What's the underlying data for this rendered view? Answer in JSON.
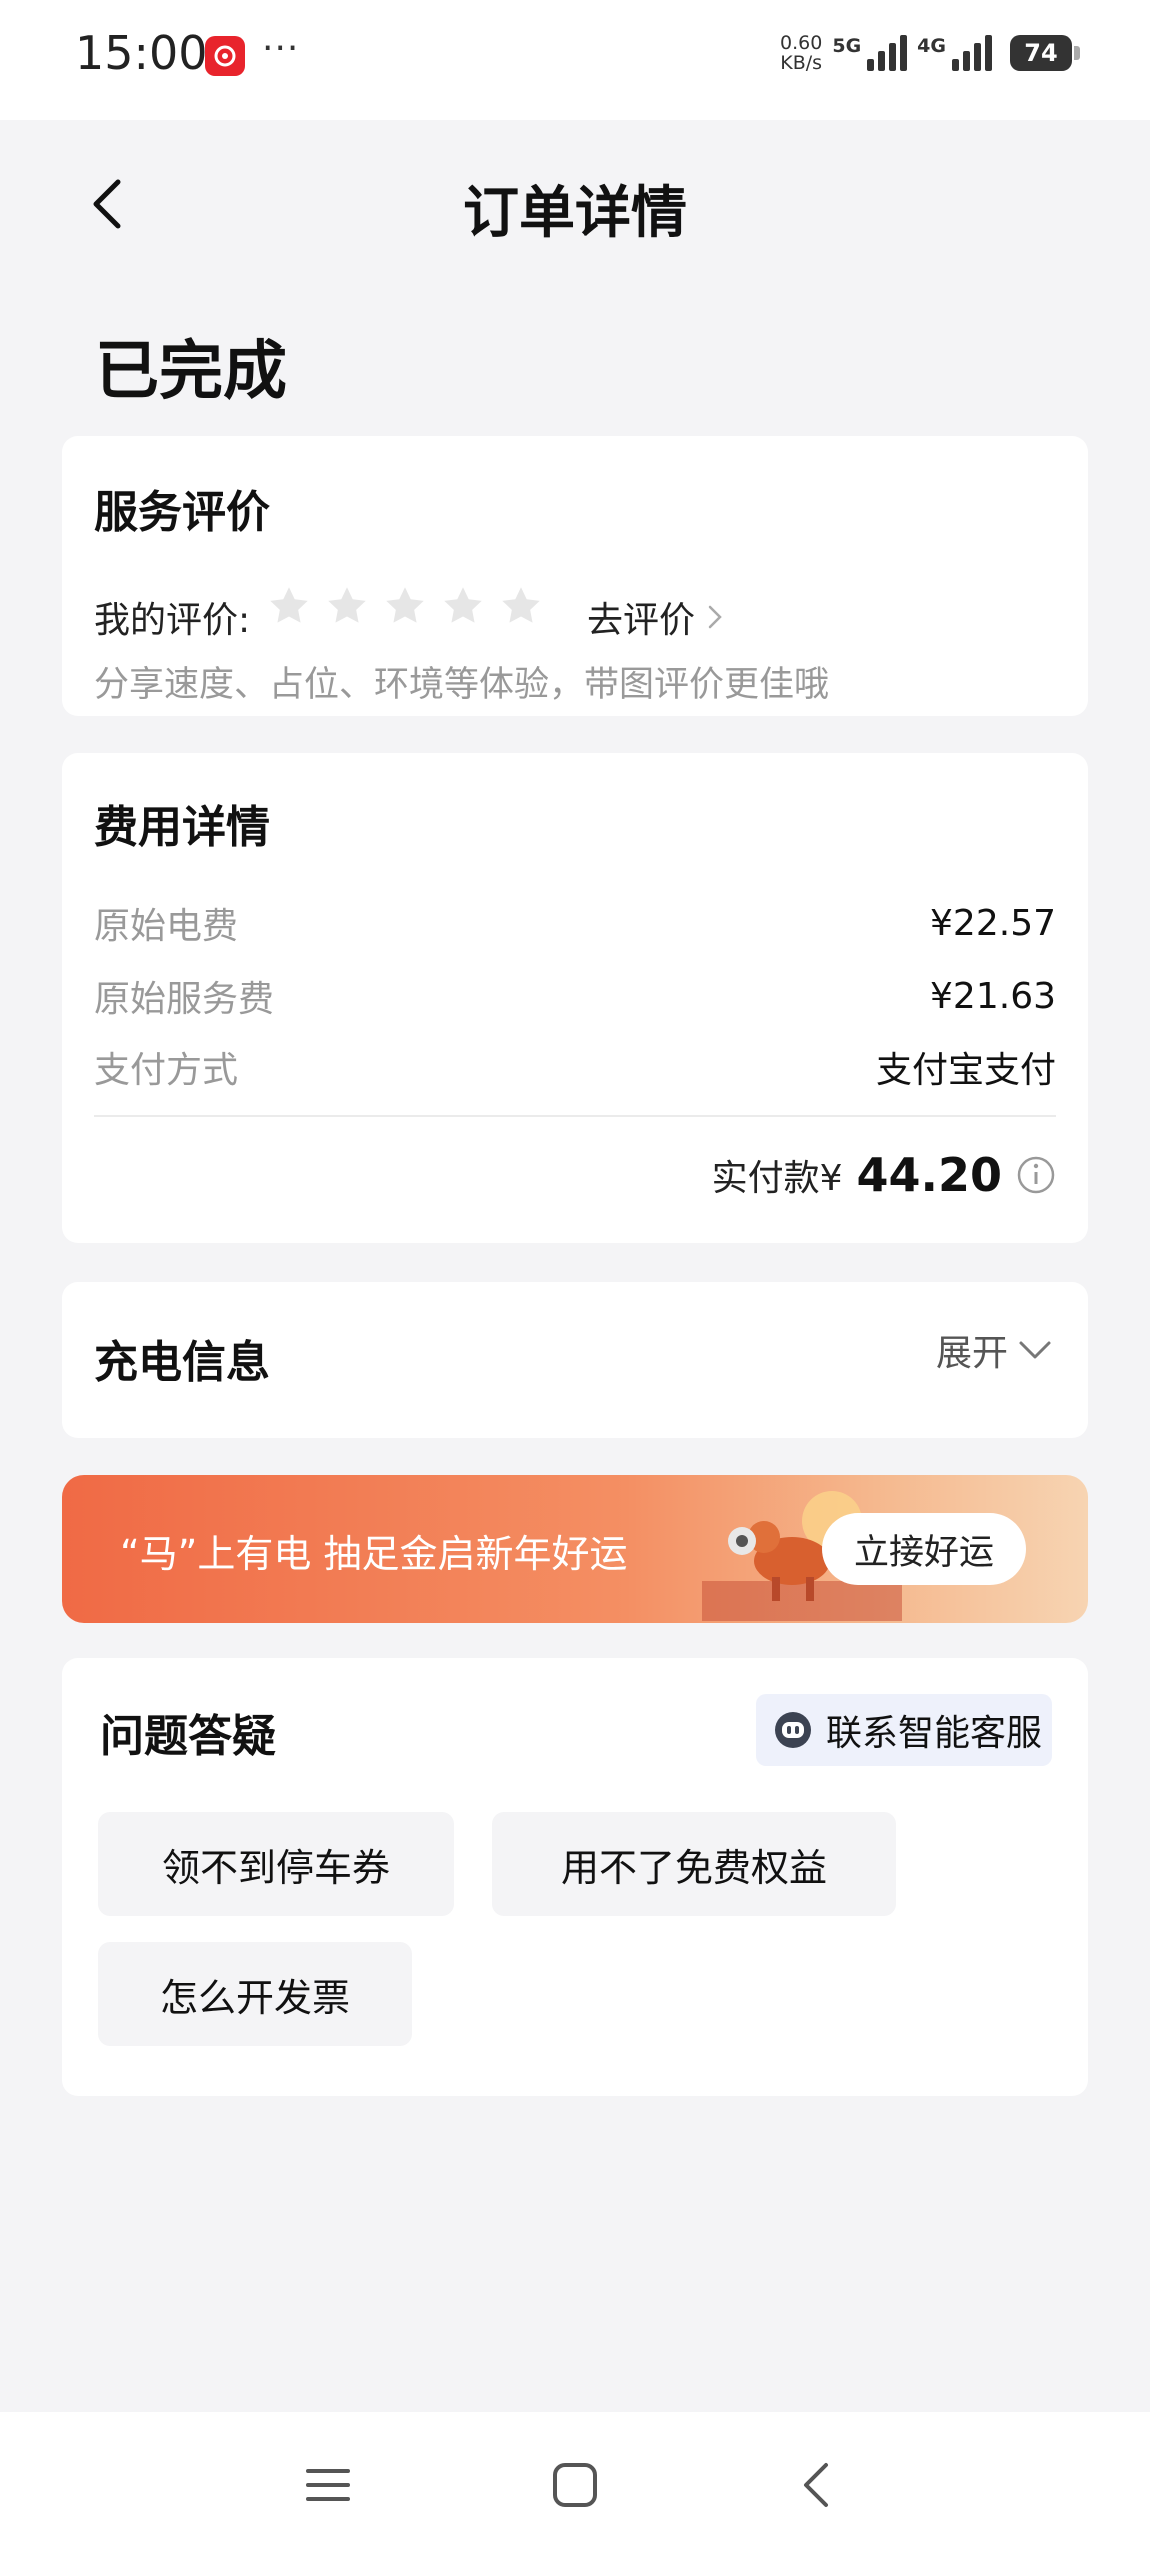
{
  "status_bar": {
    "time": "15:00",
    "dots": "···",
    "speed_value": "0.60",
    "speed_unit": "KB/s",
    "net1": "5G",
    "net2": "4G",
    "battery": "74"
  },
  "header": {
    "title": "订单详情"
  },
  "order_status": "已完成",
  "review": {
    "title": "服务评价",
    "label": "我的评价:",
    "stars_filled": 0,
    "stars_total": 5,
    "link": "去评价",
    "hint": "分享速度、占位、环境等体验，带图评价更佳哦"
  },
  "fees": {
    "title": "费用详情",
    "rows": [
      {
        "label": "原始电费",
        "value": "¥22.57"
      },
      {
        "label": "原始服务费",
        "value": "¥21.63"
      },
      {
        "label": "支付方式",
        "value": "支付宝支付"
      }
    ],
    "total_label": "实付款¥",
    "total_amount": "44.20"
  },
  "charging": {
    "title": "充电信息",
    "expand": "展开"
  },
  "banner": {
    "text": "“马”上有电 抽足金启新年好运",
    "button": "立接好运"
  },
  "faq": {
    "title": "问题答疑",
    "contact": "联系智能客服",
    "chips": [
      "领不到停车券",
      "用不了免费权益",
      "怎么开发票"
    ]
  },
  "colors": {
    "accent": "#f06a45",
    "background": "#f4f4f6",
    "muted_text": "#999999",
    "star_empty": "#e6e6e6"
  }
}
